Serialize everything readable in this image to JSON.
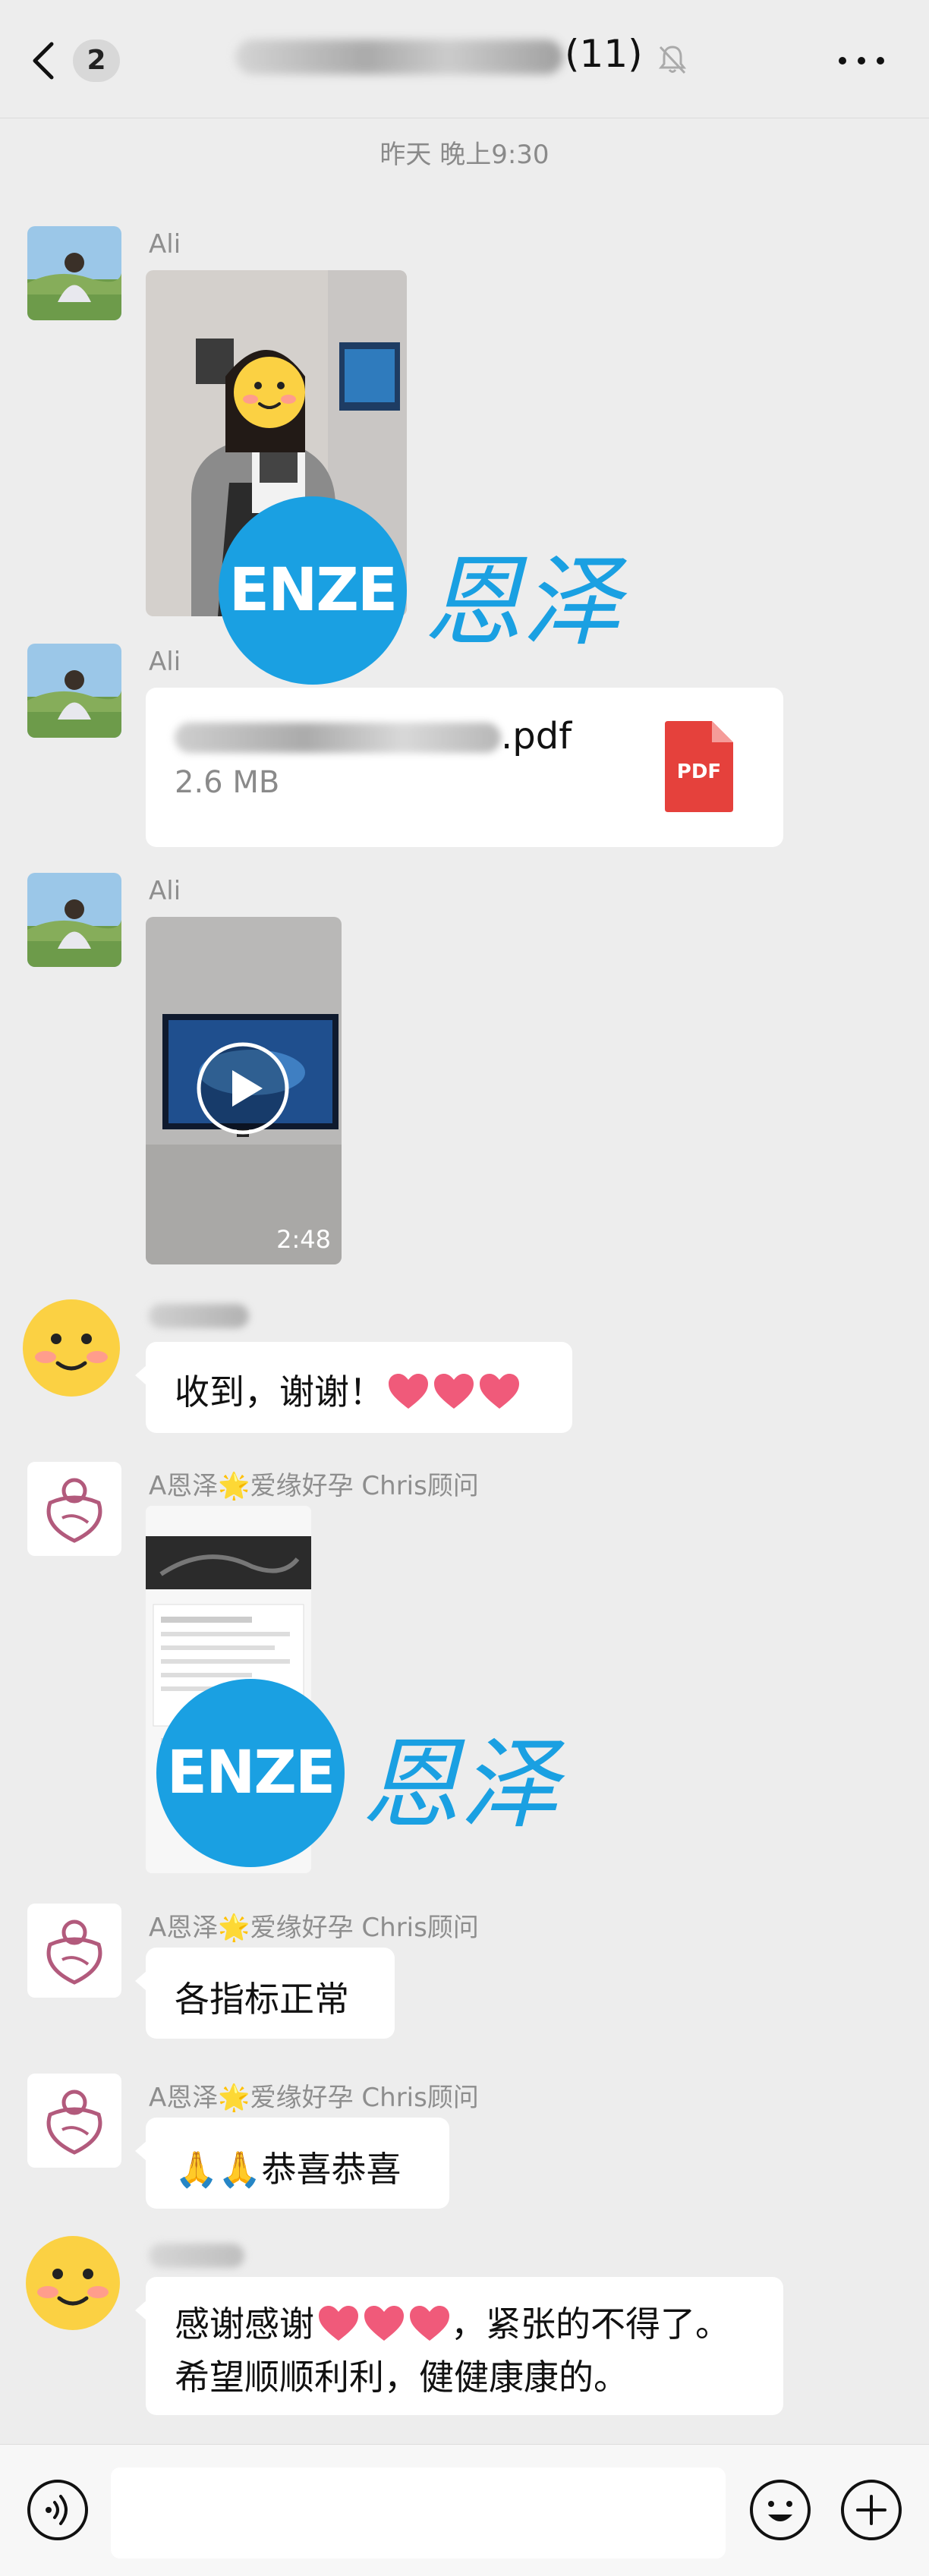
{
  "header": {
    "back_count": "2",
    "member_count": "(11)"
  },
  "timestamp": "昨天 晚上9:30",
  "messages": {
    "m1": {
      "sender": "Ali"
    },
    "m2": {
      "sender": "Ali",
      "file_name": ".pdf",
      "file_size": "2.6 MB",
      "file_type": "PDF"
    },
    "m3": {
      "sender": "Ali",
      "video_duration": "2:48"
    },
    "m4": {
      "text": "收到，谢谢！"
    },
    "m5": {
      "sender": "A恩泽🌟爱缘好孕 Chris顾问"
    },
    "m6": {
      "sender": "A恩泽🌟爱缘好孕 Chris顾问",
      "text": "各指标正常"
    },
    "m7": {
      "sender": "A恩泽🌟爱缘好孕 Chris顾问",
      "text": "🙏🙏恭喜恭喜"
    },
    "m8": {
      "line1_start": "感谢感谢",
      "line1_end": "，紧张的不得了。",
      "line2": "希望顺顺利利，健健康康的。"
    }
  },
  "watermark": {
    "badge": "ENZE",
    "text": "恩泽"
  },
  "colors": {
    "background": "#ededed",
    "bubble": "#ffffff",
    "accent": "#1aa0e2",
    "pdf_red": "#e5413c"
  },
  "icons": [
    "back-chevron-icon",
    "mute-bell-icon",
    "more-dots-icon",
    "pdf-file-icon",
    "play-icon",
    "voice-icon",
    "emoji-icon",
    "plus-icon"
  ]
}
